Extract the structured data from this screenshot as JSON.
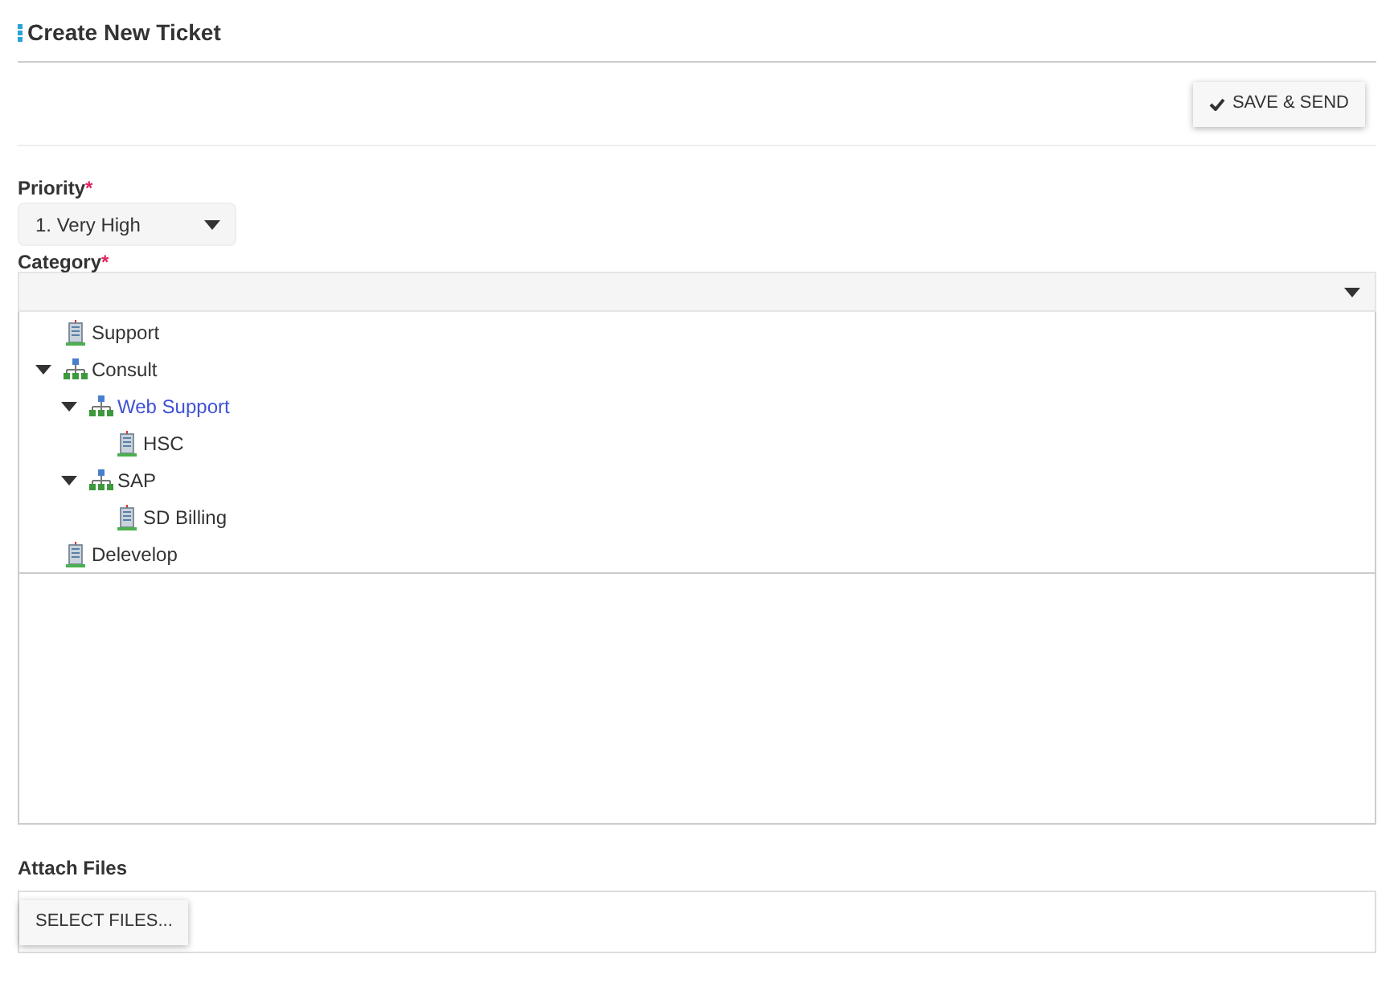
{
  "title": "Create New Ticket",
  "save_button": {
    "label": "SAVE & SEND"
  },
  "priority": {
    "label": "Priority",
    "required_mark": "*",
    "value": "1. Very High"
  },
  "category": {
    "label": "Category",
    "required_mark": "*",
    "tree": [
      {
        "label": "Support",
        "kind": "building",
        "selected": false
      },
      {
        "label": "Consult",
        "kind": "org",
        "selected": false,
        "expanded": true,
        "children": [
          {
            "label": "Web Support",
            "kind": "org",
            "selected": true,
            "expanded": true,
            "children": [
              {
                "label": "HSC",
                "kind": "building",
                "selected": false
              }
            ]
          },
          {
            "label": "SAP",
            "kind": "org",
            "selected": false,
            "expanded": true,
            "children": [
              {
                "label": "SD Billing",
                "kind": "building",
                "selected": false
              }
            ]
          }
        ]
      },
      {
        "label": "Delevelop",
        "kind": "building",
        "selected": false
      }
    ]
  },
  "attach": {
    "label": "Attach Files",
    "button": "SELECT FILES..."
  }
}
